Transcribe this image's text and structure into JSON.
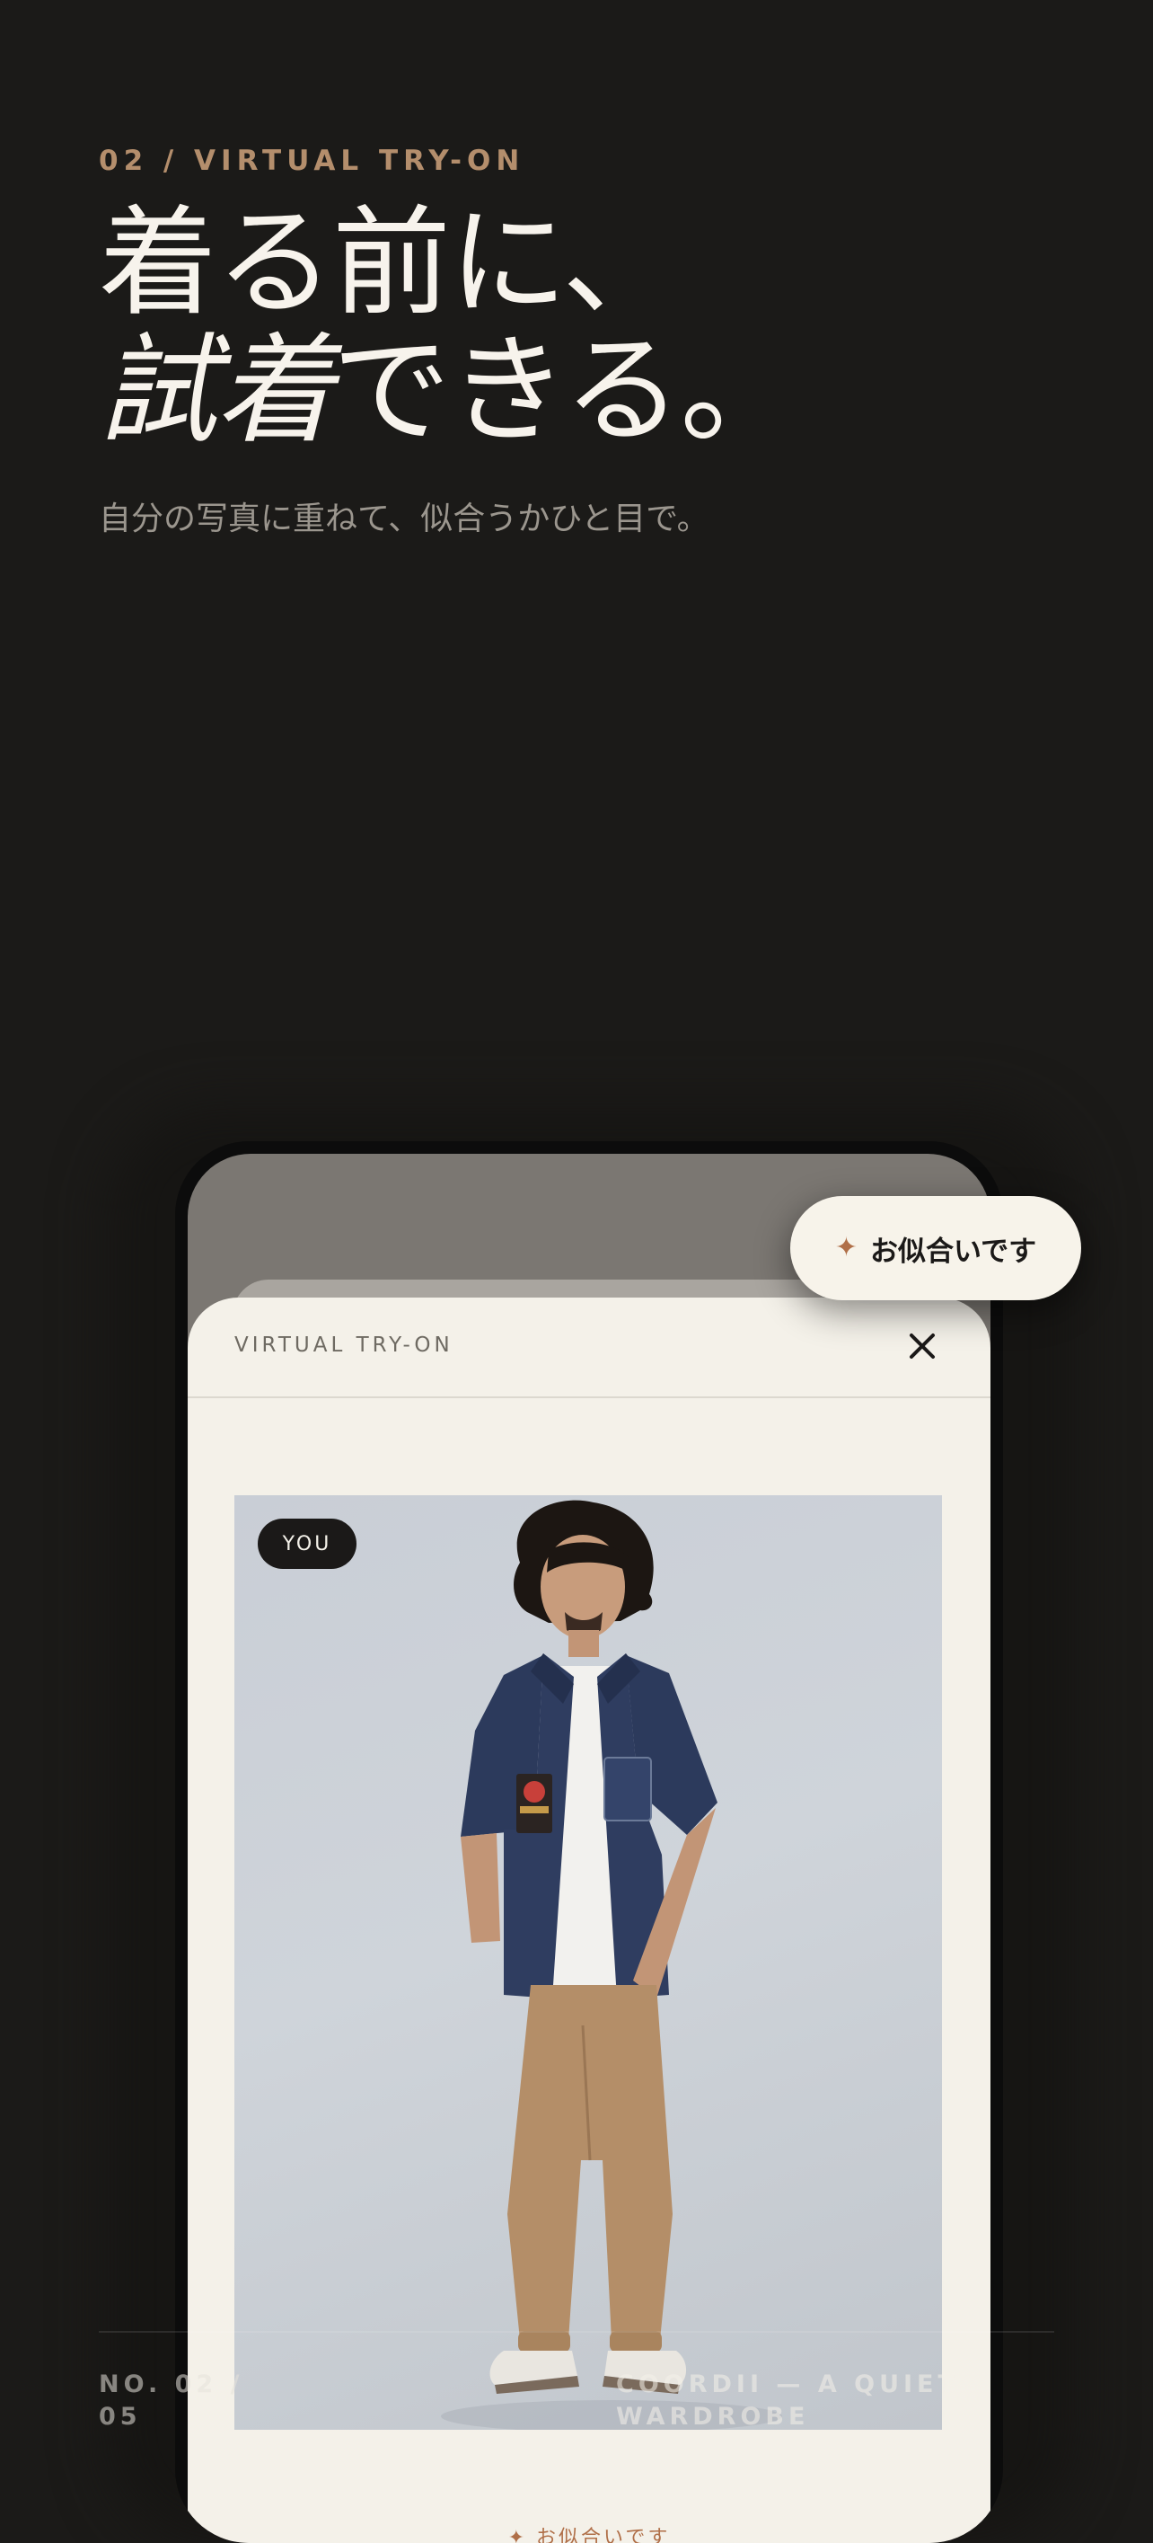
{
  "hero": {
    "eyebrow": "02 / VIRTUAL TRY-ON",
    "headline_line1": "着る前に、",
    "headline_line2_italic": "試着",
    "headline_line2_rest": "できる。",
    "subtitle": "自分の写真に重ねて、似合うかひと目で。"
  },
  "try_on_sheet": {
    "title": "VIRTUAL TRY-ON",
    "close_icon": "close-icon",
    "photo_badge": "YOU",
    "footer_label": "✦ お似合いです"
  },
  "match_pill": {
    "icon": "sparkle-icon",
    "label": "お似合いです"
  },
  "footer": {
    "left": "NO. 02 / 05",
    "right": "COORDII — A QUIET WARDROBE"
  },
  "colors": {
    "background": "#1b1a18",
    "accent": "#b48e6c",
    "sheet": "#f4f1e9",
    "spark": "#b06f48"
  }
}
